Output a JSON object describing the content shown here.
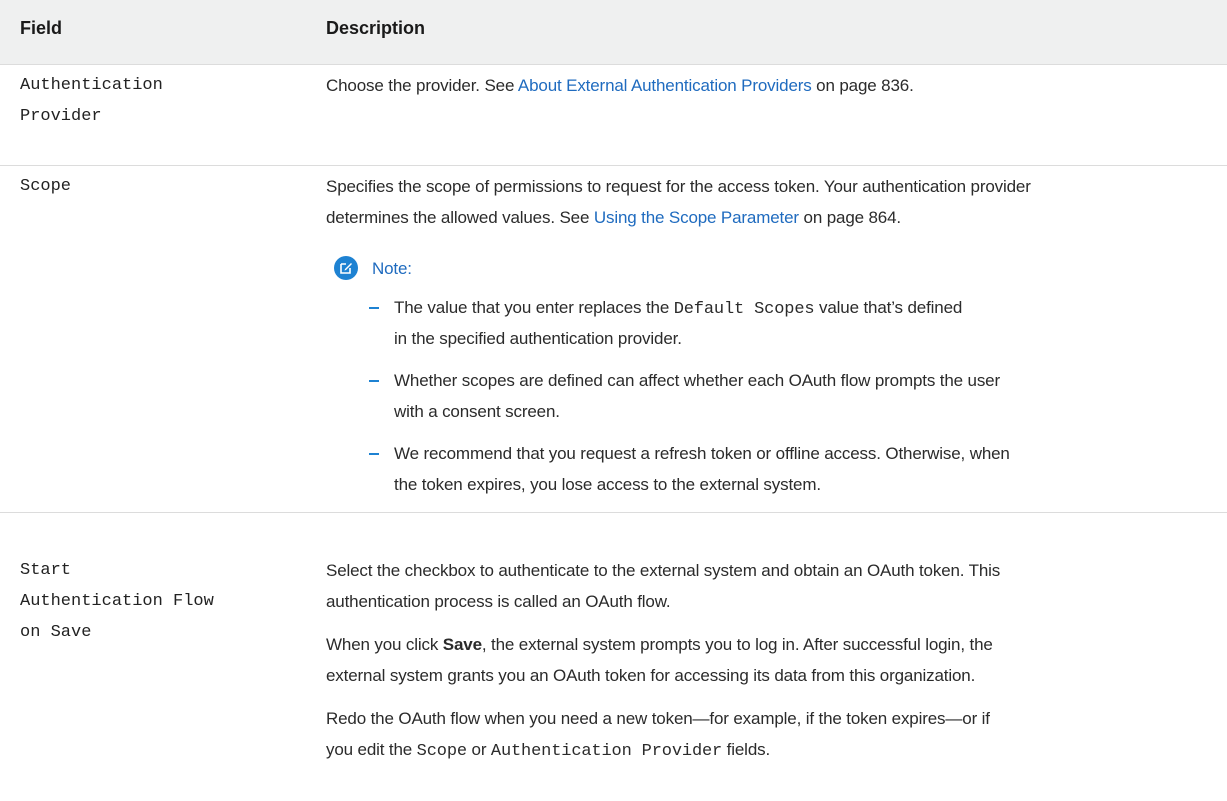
{
  "header": {
    "field": "Field",
    "description": "Description"
  },
  "rows": {
    "auth_provider": {
      "field_lines": [
        "Authentication",
        "Provider"
      ],
      "desc": {
        "prefix": "Choose the provider. See ",
        "link": "About External Authentication Providers",
        "suffix": " on page 836."
      }
    },
    "scope": {
      "field_lines": [
        "Scope"
      ],
      "desc_line1": "Specifies the scope of permissions to request for the access token. Your authentication provider",
      "desc_line2": {
        "prefix": "determines the allowed values. See ",
        "link": "Using the Scope Parameter",
        "suffix": " on page 864."
      },
      "note": {
        "icon": "edit-note-icon",
        "label": "Note:",
        "bullets": [
          {
            "line1": {
              "prefix": "The value that you enter replaces the ",
              "code": "Default Scopes",
              "suffix": " value that’s defined"
            },
            "line2": "in the specified authentication provider."
          },
          {
            "line1": "Whether scopes are defined can affect whether each OAuth flow prompts the user",
            "line2": "with a consent screen."
          },
          {
            "line1": "We recommend that you request a refresh token or offline access. Otherwise, when",
            "line2": "the token expires, you lose access to the external system."
          }
        ]
      }
    },
    "start_auth": {
      "field_lines": [
        "Start",
        "Authentication Flow",
        "on Save"
      ],
      "p1_line1": "Select the checkbox to authenticate to the external system and obtain an OAuth token. This",
      "p1_line2": "authentication process is called an OAuth flow.",
      "p2_line1": {
        "prefix": "When you click ",
        "bold": "Save",
        "suffix": ", the external system prompts you to log in. After successful login, the"
      },
      "p2_line2": "external system grants you an OAuth token for accessing its data from this organization.",
      "p3_line1": "Redo the OAuth flow when you need a new token—for example, if the token expires—or if",
      "p3_line2": {
        "prefix": "you edit the ",
        "code1": "Scope",
        "mid": " or ",
        "code2": "Authentication Provider",
        "suffix": " fields."
      }
    }
  },
  "colors": {
    "link": "#1f6bbf",
    "accent": "#1e82d2",
    "header_bg": "#eff0f0",
    "rule": "#dcdcdc"
  }
}
